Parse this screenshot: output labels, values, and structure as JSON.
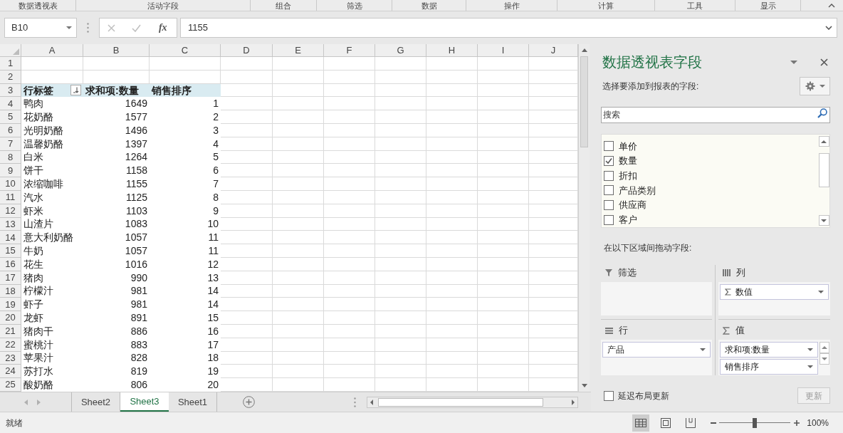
{
  "ribbon_groups": [
    "数据透视表",
    "活动字段",
    "组合",
    "筛选",
    "数据",
    "操作",
    "计算",
    "工具",
    "显示"
  ],
  "formula_bar": {
    "name_box": "B10",
    "function_button": "fx",
    "formula": "1155"
  },
  "sheet": {
    "columns": [
      "A",
      "B",
      "C",
      "D",
      "E",
      "F",
      "G",
      "H",
      "I",
      "J"
    ],
    "row_numbers": [
      "1",
      "2",
      "3",
      "4",
      "5",
      "6",
      "7",
      "8",
      "9",
      "10",
      "11",
      "12",
      "13",
      "14",
      "15",
      "16",
      "17",
      "18",
      "19",
      "20",
      "21",
      "22",
      "23",
      "24",
      "25"
    ],
    "pivot_table": {
      "header": {
        "label": "行标签",
        "values": [
          "求和项:数量",
          "销售排序"
        ]
      },
      "rows": [
        {
          "label": "鸭肉",
          "values": [
            "1649",
            "1"
          ]
        },
        {
          "label": "花奶酪",
          "values": [
            "1577",
            "2"
          ]
        },
        {
          "label": "光明奶酪",
          "values": [
            "1496",
            "3"
          ]
        },
        {
          "label": "温馨奶酪",
          "values": [
            "1397",
            "4"
          ]
        },
        {
          "label": "白米",
          "values": [
            "1264",
            "5"
          ]
        },
        {
          "label": "饼干",
          "values": [
            "1158",
            "6"
          ]
        },
        {
          "label": "浓缩咖啡",
          "values": [
            "1155",
            "7"
          ]
        },
        {
          "label": "汽水",
          "values": [
            "1125",
            "8"
          ]
        },
        {
          "label": "虾米",
          "values": [
            "1103",
            "9"
          ]
        },
        {
          "label": "山渣片",
          "values": [
            "1083",
            "10"
          ]
        },
        {
          "label": "意大利奶酪",
          "values": [
            "1057",
            "11"
          ]
        },
        {
          "label": "牛奶",
          "values": [
            "1057",
            "11"
          ]
        },
        {
          "label": "花生",
          "values": [
            "1016",
            "12"
          ]
        },
        {
          "label": "猪肉",
          "values": [
            "990",
            "13"
          ]
        },
        {
          "label": "柠檬汁",
          "values": [
            "981",
            "14"
          ]
        },
        {
          "label": "虾子",
          "values": [
            "981",
            "14"
          ]
        },
        {
          "label": "龙虾",
          "values": [
            "891",
            "15"
          ]
        },
        {
          "label": "猪肉干",
          "values": [
            "886",
            "16"
          ]
        },
        {
          "label": "蜜桃汁",
          "values": [
            "883",
            "17"
          ]
        },
        {
          "label": "苹果汁",
          "values": [
            "828",
            "18"
          ]
        },
        {
          "label": "苏打水",
          "values": [
            "819",
            "19"
          ]
        },
        {
          "label": "酸奶酪",
          "values": [
            "806",
            "20"
          ]
        }
      ]
    }
  },
  "sheet_tabs": [
    {
      "label": "Sheet2",
      "selected": false
    },
    {
      "label": "Sheet3",
      "selected": true
    },
    {
      "label": "Sheet1",
      "selected": false
    }
  ],
  "field_pane": {
    "title": "数据透视表字段",
    "prompt": "选择要添加到报表的字段:",
    "search_placeholder": "搜索",
    "fields": [
      {
        "label": "单价",
        "checked": false
      },
      {
        "label": "数量",
        "checked": true
      },
      {
        "label": "折扣",
        "checked": false
      },
      {
        "label": "产品类别",
        "checked": false
      },
      {
        "label": "供应商",
        "checked": false
      },
      {
        "label": "客户",
        "checked": false
      }
    ],
    "drag_prompt": "在以下区域间拖动字段:",
    "areas": [
      {
        "kind": "filter",
        "label": "筛选"
      },
      {
        "kind": "columns",
        "label": "列",
        "items": [
          {
            "label": "数值",
            "kind": "values"
          }
        ]
      },
      {
        "kind": "rows",
        "label": "行",
        "items": [
          {
            "label": "产品",
            "kind": "field"
          }
        ]
      },
      {
        "kind": "values",
        "label": "值",
        "items": [
          {
            "label": "求和项:数量",
            "kind": "field"
          },
          {
            "label": "销售排序",
            "kind": "field"
          }
        ]
      }
    ],
    "defer_update": {
      "label": "延迟布局更新",
      "checked": false
    },
    "update_button": {
      "label": "更新",
      "disabled": true
    }
  },
  "status_bar": {
    "text": "就绪",
    "views": [
      {
        "kind": "normal",
        "selected": true
      },
      {
        "kind": "page_layout",
        "selected": false
      },
      {
        "kind": "page_break",
        "selected": false
      }
    ],
    "zoom": {
      "label": "100%",
      "level": 0.5
    }
  }
}
